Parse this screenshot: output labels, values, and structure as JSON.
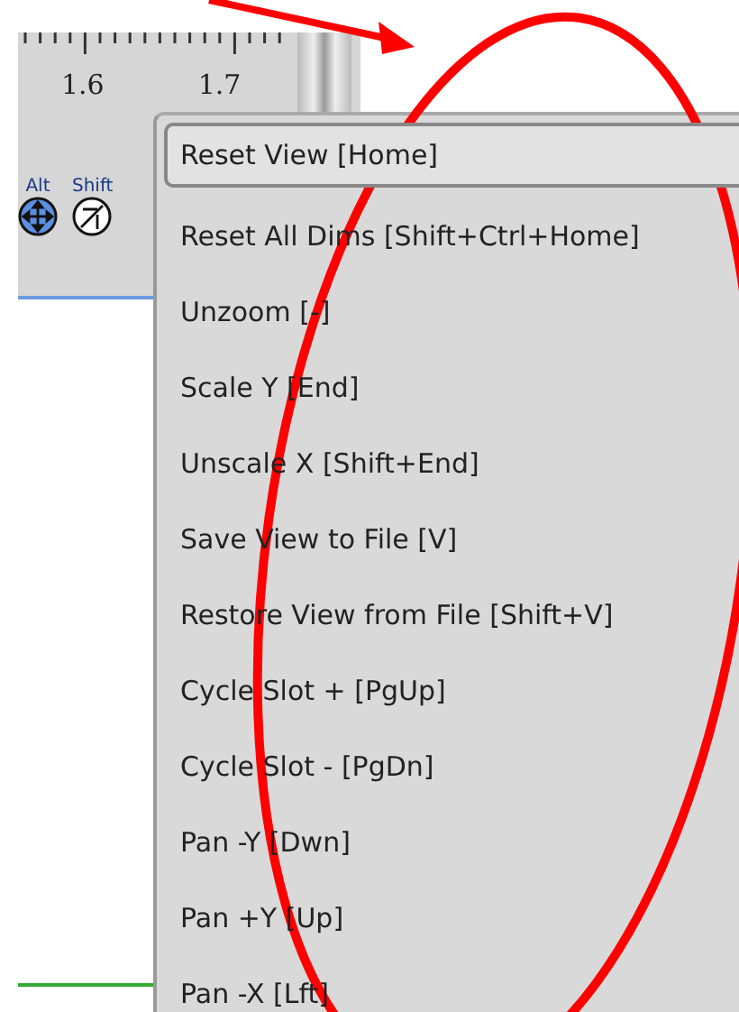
{
  "ruler": {
    "labels": [
      "1.6",
      "1.7"
    ]
  },
  "modifiers": [
    {
      "label": "Alt",
      "kind": "move"
    },
    {
      "label": "Shift",
      "kind": "scale"
    }
  ],
  "context_menu": {
    "items": [
      {
        "label": "Reset View [Home]",
        "selected": true
      },
      {
        "label": "Reset All Dims [Shift+Ctrl+Home]",
        "selected": false
      },
      {
        "label": "Unzoom [-]",
        "selected": false
      },
      {
        "label": "Scale Y [End]",
        "selected": false
      },
      {
        "label": "Unscale X [Shift+End]",
        "selected": false
      },
      {
        "label": "Save View to File [V]",
        "selected": false
      },
      {
        "label": "Restore View from File [Shift+V]",
        "selected": false
      },
      {
        "label": "Cycle Slot + [PgUp]",
        "selected": false
      },
      {
        "label": "Cycle Slot - [PgDn]",
        "selected": false
      },
      {
        "label": "Pan -Y [Dwn]",
        "selected": false
      },
      {
        "label": "Pan +Y [Up]",
        "selected": false
      },
      {
        "label": "Pan -X [Lft]",
        "selected": false
      }
    ]
  }
}
